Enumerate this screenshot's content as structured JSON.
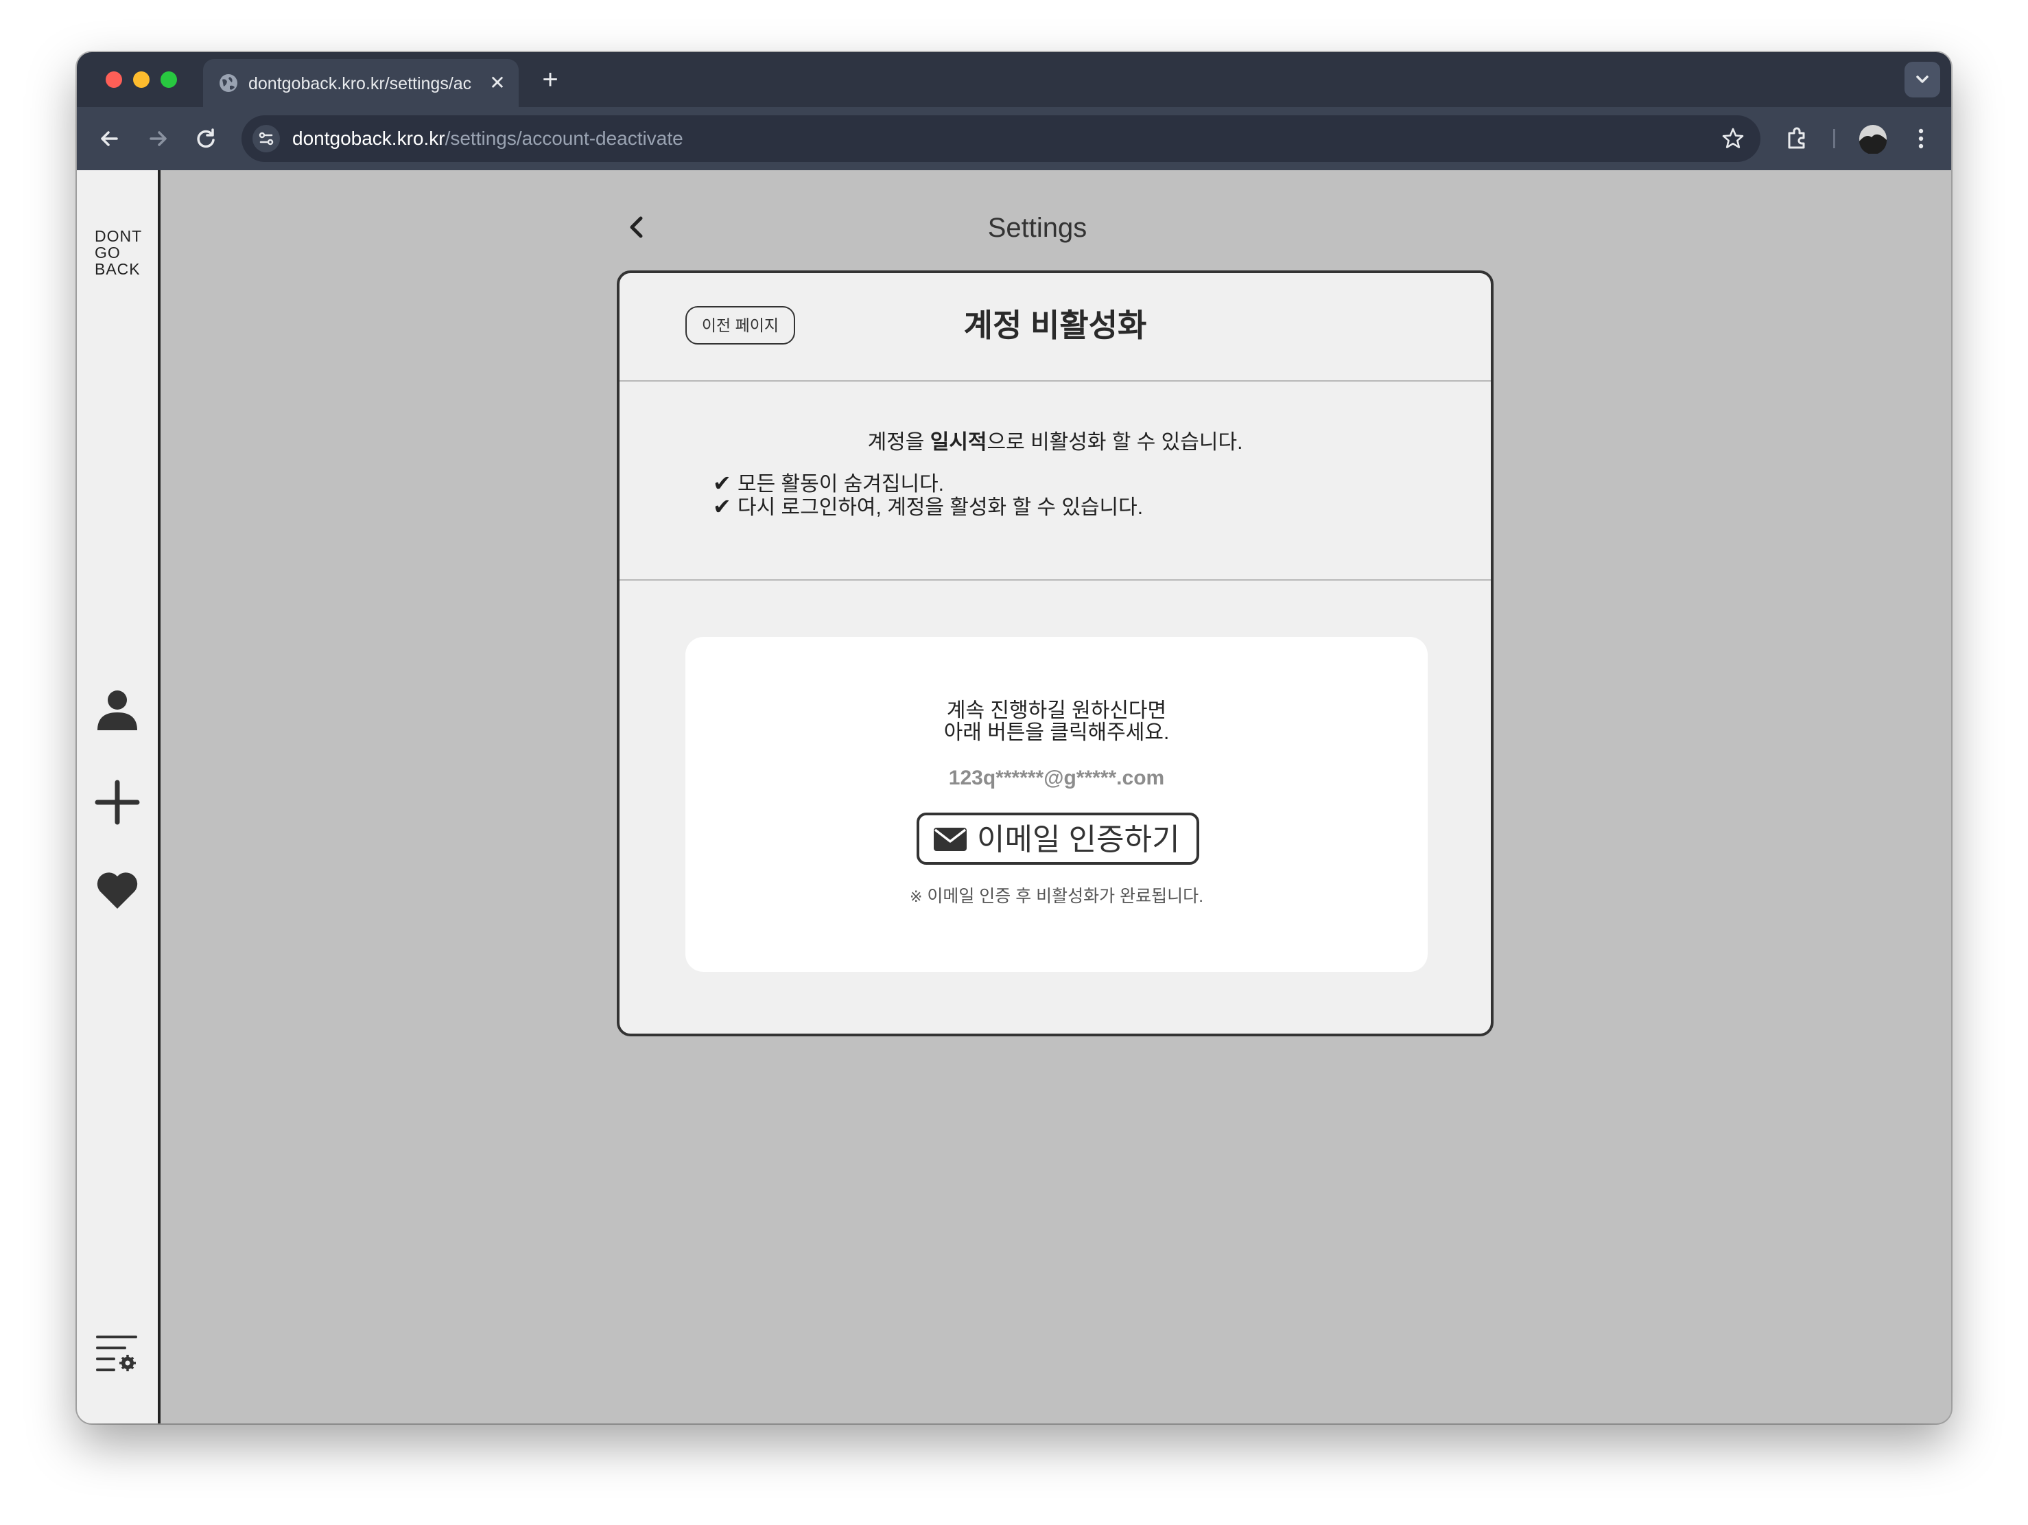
{
  "browser": {
    "tab_title": "dontgoback.kro.kr/settings/ac",
    "close_glyph": "✕",
    "new_tab_glyph": "+",
    "url_host": "dontgoback.kro.kr",
    "url_path": "/settings/account-deactivate"
  },
  "sidebar": {
    "logo": [
      "DONT",
      "GO",
      "BACK"
    ],
    "icons": [
      "user-icon",
      "plus-icon",
      "heart-icon",
      "settings-menu-icon"
    ]
  },
  "header": {
    "title": "Settings"
  },
  "card": {
    "prev_button": "이전 페이지",
    "title": "계정 비활성화",
    "info": {
      "prefix": "계정을 ",
      "emphasis": "일시적",
      "suffix": "으로 비활성화 할 수 있습니다."
    },
    "checks": [
      "모든 활동이 숨겨집니다.",
      "다시 로그인하여, 계정을 활성화 할 수 있습니다."
    ],
    "check_glyph": "✔",
    "inner": {
      "message_lines": [
        "계속 진행하길 원하신다면",
        "아래 버튼을 클릭해주세요."
      ],
      "masked_email": "123q******@g*****.com",
      "verify_button": "이메일 인증하기",
      "note_mark": "※",
      "note": "이메일 인증 후 비활성화가 완료됩니다."
    }
  }
}
